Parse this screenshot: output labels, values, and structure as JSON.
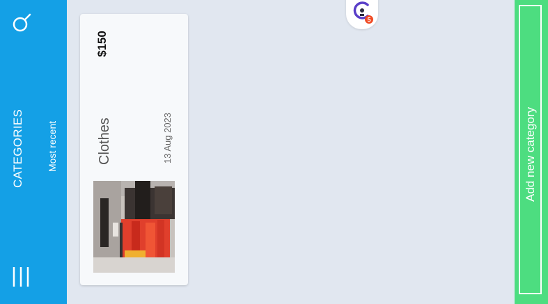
{
  "sidebar": {
    "title": "CATEGORIES",
    "sort_label": "Most recent",
    "search_icon": "search-icon",
    "menu_icon": "menu-icon"
  },
  "categories": [
    {
      "name": "Clothes",
      "amount": "$150",
      "date": "13 Aug 2023",
      "image": "clothing-store-photo"
    }
  ],
  "fab": {
    "icon": "app-logo-icon",
    "badge": "5"
  },
  "add_panel": {
    "label": "Add new category"
  },
  "colors": {
    "sidebar": "#14a0e6",
    "background": "#e1e7f0",
    "add_button": "#4ddd80",
    "card": "#f7f9fb"
  }
}
